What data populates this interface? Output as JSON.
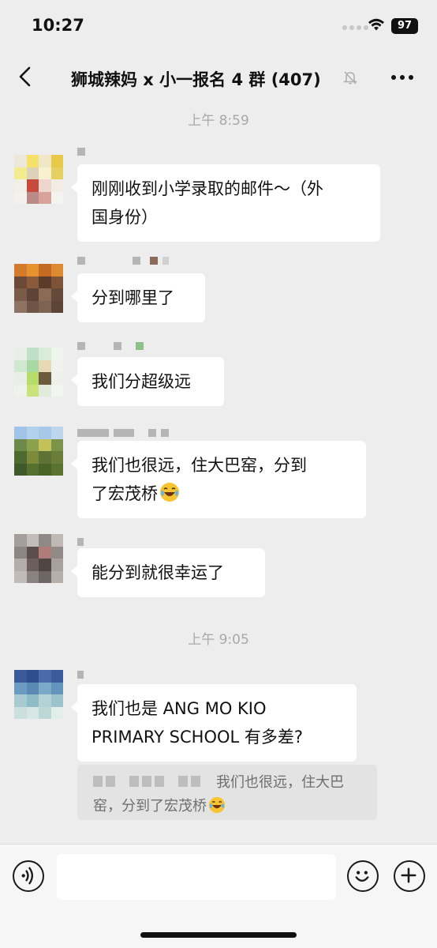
{
  "status_bar": {
    "time": "10:27",
    "battery": "97"
  },
  "header": {
    "title": "狮城辣妈 x 小一报名 4 群 (407)"
  },
  "messages": [
    {
      "type": "time",
      "text": "上午 8:59"
    },
    {
      "type": "msg",
      "lines": [
        "刚刚收到小学录取的邮件～（外",
        "国身份）"
      ]
    },
    {
      "type": "msg",
      "lines": [
        "分到哪里了"
      ]
    },
    {
      "type": "msg",
      "lines": [
        "我们分超级远"
      ]
    },
    {
      "type": "msg",
      "lines": [
        "我们也很远，住大巴窑，分到",
        "了宏茂桥"
      ],
      "emoji": "laugh-cry-emoji"
    },
    {
      "type": "msg",
      "lines": [
        "能分到就很幸运了"
      ]
    },
    {
      "type": "time",
      "text": "上午 9:05"
    },
    {
      "type": "msg",
      "lines": [
        "我们也是 ANG MO KIO",
        "PRIMARY SCHOOL 有多差?"
      ]
    }
  ],
  "quote": {
    "line1": "我们也很远，住大巴",
    "line2": "窑，分到了宏茂桥",
    "emoji": "laugh-cry-emoji"
  },
  "input": {
    "placeholder": ""
  },
  "colors": {
    "background": "#ededed",
    "bubble": "#ffffff",
    "timestamp": "#a8a8a8",
    "quote_bg": "#e3e3e3"
  }
}
